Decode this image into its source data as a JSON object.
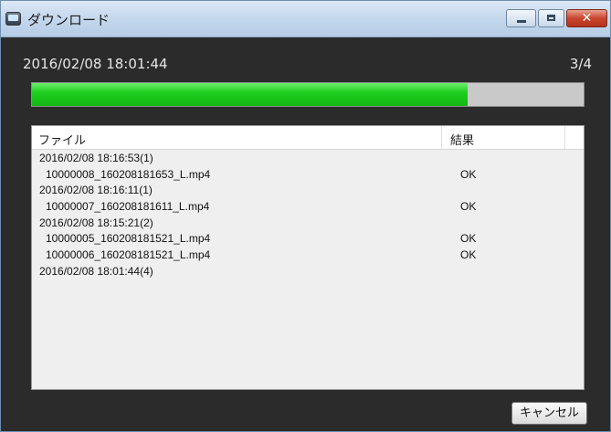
{
  "window": {
    "title": "ダウンロード"
  },
  "status": {
    "datetime": "2016/02/08 18:01:44",
    "counter": "3/4",
    "progress": 0.79
  },
  "list": {
    "headers": {
      "file": "ファイル",
      "result": "結果"
    },
    "rows": [
      {
        "type": "group",
        "text": "2016/02/08 18:16:53(1)",
        "result": ""
      },
      {
        "type": "file",
        "text": "10000008_160208181653_L.mp4",
        "result": "OK"
      },
      {
        "type": "group",
        "text": "2016/02/08 18:16:11(1)",
        "result": ""
      },
      {
        "type": "file",
        "text": "10000007_160208181611_L.mp4",
        "result": "OK"
      },
      {
        "type": "group",
        "text": "2016/02/08 18:15:21(2)",
        "result": ""
      },
      {
        "type": "file",
        "text": "10000005_160208181521_L.mp4",
        "result": "OK"
      },
      {
        "type": "file",
        "text": "10000006_160208181521_L.mp4",
        "result": "OK"
      },
      {
        "type": "group",
        "text": "2016/02/08 18:01:44(4)",
        "result": ""
      }
    ]
  },
  "buttons": {
    "cancel": "キャンセル"
  },
  "icons": {
    "app": "download-app-icon",
    "minimize": "minimize-icon",
    "maximize": "maximize-icon",
    "close": "close-icon"
  },
  "colors": {
    "progress_fill": "#1fce1f",
    "window_bg": "#2b2b2b",
    "close_button": "#c9462e"
  }
}
